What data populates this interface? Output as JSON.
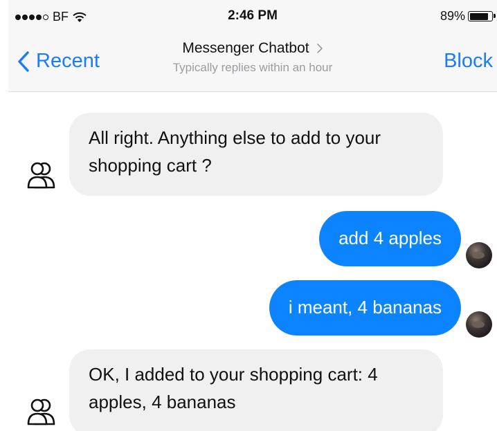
{
  "status_bar": {
    "carrier": "BF",
    "time": "2:46 PM",
    "battery_percent": "89%",
    "battery_level": 0.89,
    "signal_dots": [
      true,
      true,
      true,
      true,
      false
    ]
  },
  "nav": {
    "back_label": "Recent",
    "title": "Messenger Chatbot",
    "subtitle": "Typically replies within an hour",
    "block_label": "Block"
  },
  "colors": {
    "accent": "#1a7cf6",
    "outgoing_bubble": "#0c84ff",
    "incoming_bubble": "#f0f0f1"
  },
  "icons": {
    "back": "chevron-left-icon",
    "title_disclosure": "chevron-right-icon",
    "bot_avatar": "bot-avatar-icon",
    "user_avatar": "user-avatar"
  },
  "messages": [
    {
      "from": "bot",
      "text": "All right. Anything else to add to your shopping cart ?"
    },
    {
      "from": "user",
      "text": "add 4 apples"
    },
    {
      "from": "user",
      "text": "i meant, 4 bananas"
    },
    {
      "from": "bot",
      "text": "OK, I added to your shopping cart: 4 apples, 4 bananas"
    }
  ]
}
